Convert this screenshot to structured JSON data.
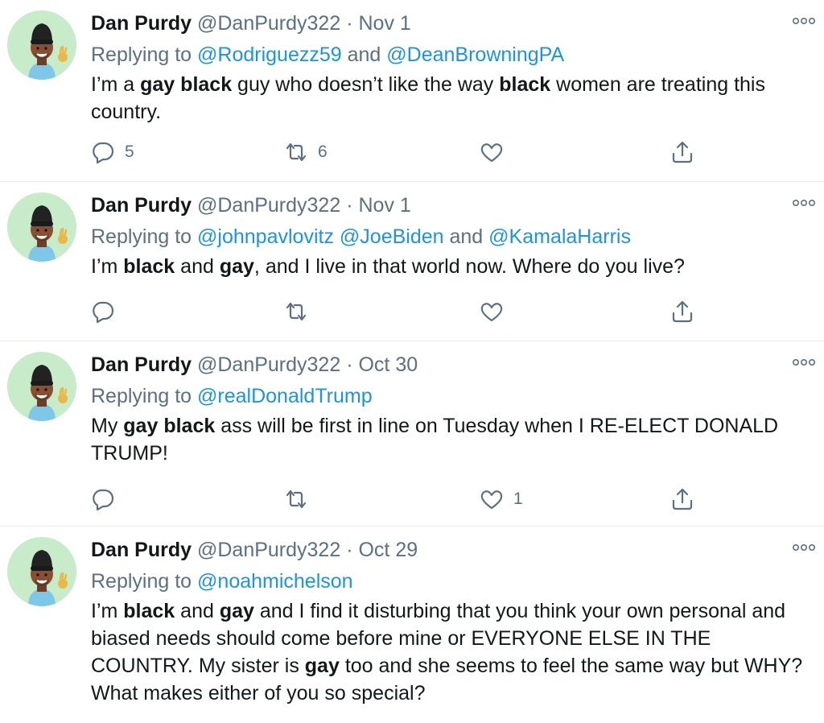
{
  "tweets": [
    {
      "name": "Dan Purdy",
      "handle": "@DanPurdy322",
      "sep": "·",
      "date": "Nov 1",
      "replying_prefix": "Replying to ",
      "replying_to": [
        {
          "text": "@Rodriguezz59",
          "after": " and "
        },
        {
          "text": "@DeanBrowningPA",
          "after": ""
        }
      ],
      "body": [
        {
          "t": "I’m a ",
          "b": false
        },
        {
          "t": "gay",
          "b": true
        },
        {
          "t": " ",
          "b": false
        },
        {
          "t": "black",
          "b": true
        },
        {
          "t": " guy who doesn’t like the way ",
          "b": false
        },
        {
          "t": "black",
          "b": true
        },
        {
          "t": " women are treating this country.",
          "b": false
        }
      ],
      "replies": "5",
      "retweets": "6",
      "likes": ""
    },
    {
      "name": "Dan Purdy",
      "handle": "@DanPurdy322",
      "sep": "·",
      "date": "Nov 1",
      "replying_prefix": "Replying to ",
      "replying_to": [
        {
          "text": "@johnpavlovitz",
          "after": " "
        },
        {
          "text": "@JoeBiden",
          "after": " and "
        },
        {
          "text": "@KamalaHarris",
          "after": ""
        }
      ],
      "body": [
        {
          "t": "I’m ",
          "b": false
        },
        {
          "t": "black",
          "b": true
        },
        {
          "t": " and ",
          "b": false
        },
        {
          "t": "gay",
          "b": true
        },
        {
          "t": ", and I live in that world now. Where do you live?",
          "b": false
        }
      ],
      "replies": "",
      "retweets": "",
      "likes": ""
    },
    {
      "name": "Dan Purdy",
      "handle": "@DanPurdy322",
      "sep": "·",
      "date": "Oct 30",
      "replying_prefix": "Replying to ",
      "replying_to": [
        {
          "text": "@realDonaldTrump",
          "after": ""
        }
      ],
      "body": [
        {
          "t": "My ",
          "b": false
        },
        {
          "t": "gay",
          "b": true
        },
        {
          "t": " ",
          "b": false
        },
        {
          "t": "black",
          "b": true
        },
        {
          "t": " ass will be first in line on Tuesday when I RE-ELECT DONALD TRUMP!",
          "b": false
        }
      ],
      "replies": "",
      "retweets": "",
      "likes": "1"
    },
    {
      "name": "Dan Purdy",
      "handle": "@DanPurdy322",
      "sep": "·",
      "date": "Oct 29",
      "replying_prefix": "Replying to ",
      "replying_to": [
        {
          "text": "@noahmichelson",
          "after": ""
        }
      ],
      "body": [
        {
          "t": "I’m ",
          "b": false
        },
        {
          "t": "black",
          "b": true
        },
        {
          "t": " and ",
          "b": false
        },
        {
          "t": "gay",
          "b": true
        },
        {
          "t": " and I find it disturbing that you think your own personal and biased needs should come before mine or EVERYONE ELSE IN THE COUNTRY. My sister is ",
          "b": false
        },
        {
          "t": "gay",
          "b": true
        },
        {
          "t": " too and she seems to feel the same way but WHY? What makes either of you so special?",
          "b": false
        }
      ],
      "replies": "",
      "retweets": "",
      "likes": ""
    }
  ],
  "icons": {
    "more": "more-dots-icon",
    "reply": "reply-bubble-icon",
    "retweet": "retweet-arrows-icon",
    "like": "heart-icon",
    "share": "share-upload-icon",
    "avatar": "memoji-avatar"
  },
  "colors": {
    "text": "#14171a",
    "secondary": "#5b7083",
    "link": "#1b95e0",
    "divider": "#e6ecf0",
    "avatar_bg": "#c8ecc9"
  }
}
